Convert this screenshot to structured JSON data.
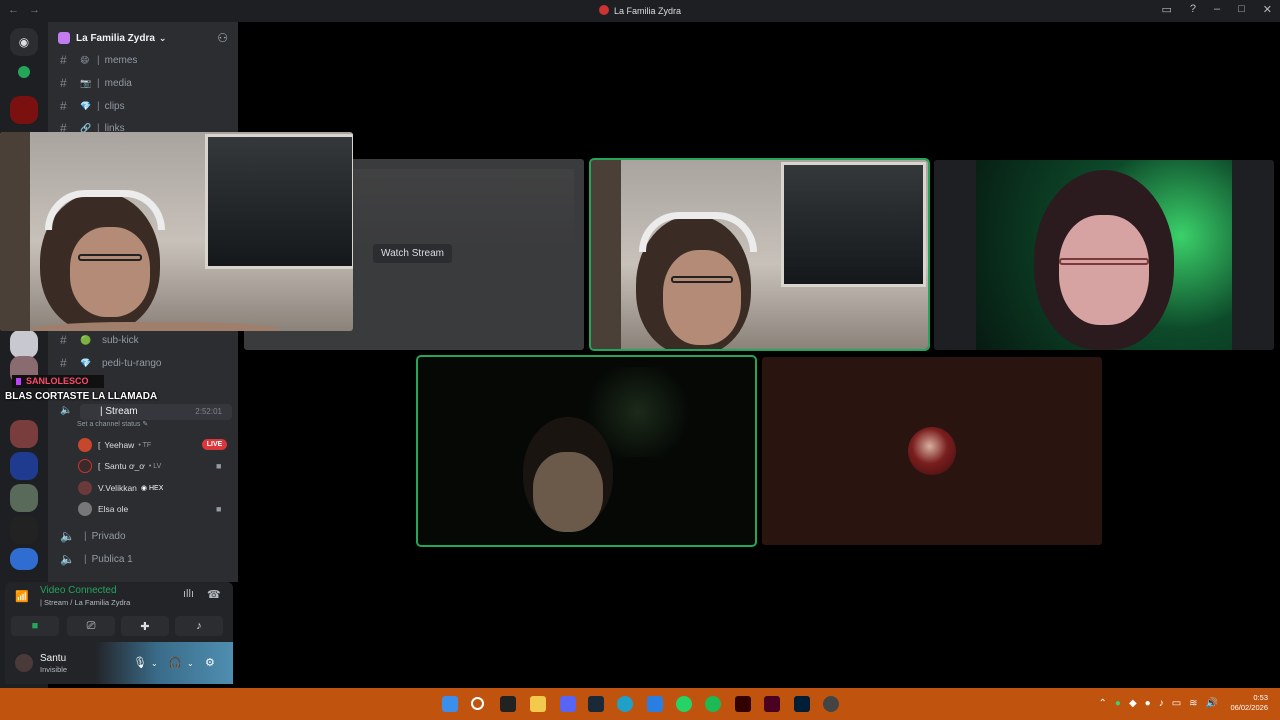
{
  "window": {
    "title": "La Familia Zydra",
    "back": "←",
    "forward": "→",
    "controls": [
      "▭",
      "?",
      "–",
      "□",
      "✕"
    ]
  },
  "server": {
    "name": "La Familia Zydra",
    "chevron": "⌄"
  },
  "text_channels": [
    {
      "emoji": "😄",
      "name": "memes"
    },
    {
      "emoji": "📷",
      "name": "media"
    },
    {
      "emoji": "💎",
      "name": "clips"
    },
    {
      "emoji": "🔗",
      "name": "links"
    },
    {
      "emoji": "🟢",
      "name": "sub-kick"
    },
    {
      "emoji": "💎",
      "name": "pedi-tu-rango"
    }
  ],
  "overlay": {
    "streamer_name": "SANLOLESCO",
    "message": "BLAS CORTASTE LA LLAMADA"
  },
  "voice_channels": {
    "stream": {
      "name": "Stream",
      "time": "2:52:01",
      "status_hint": "Set a channel status ✎"
    },
    "privado": {
      "name": "Privado"
    },
    "publica": {
      "name": "Publica 1"
    }
  },
  "members": [
    {
      "name": "Yeehaw",
      "tag": "• TF",
      "live": "LIVE"
    },
    {
      "name": "Santu ơ_ơ",
      "tag": "• LV"
    },
    {
      "name": "V.Velikkan",
      "tag": "◉ HEX"
    },
    {
      "name": "Elsa ole",
      "tag": ""
    }
  ],
  "voice_panel": {
    "status": "Video Connected",
    "channel": "Stream / La Familia Zydra"
  },
  "user": {
    "name": "Santu",
    "status": "Invisible"
  },
  "stage": {
    "watch_stream": "Watch Stream"
  },
  "taskbar": {
    "time": "0:53",
    "date": "06/02/2026"
  },
  "colors": {
    "accent_green": "#23a55a",
    "live_red": "#da373c",
    "taskbar": "#c0540e"
  }
}
